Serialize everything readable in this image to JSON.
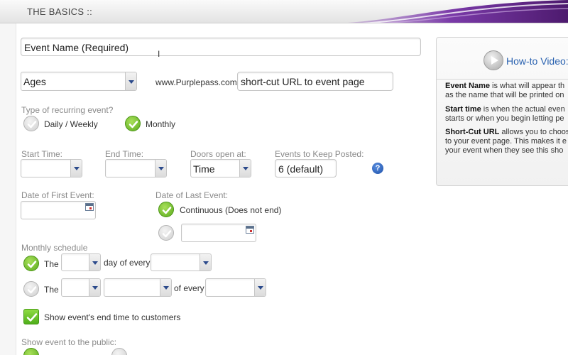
{
  "header": {
    "title": "THE BASICS ::"
  },
  "form": {
    "event_name": {
      "placeholder": "Event Name (Required)"
    },
    "ages": {
      "value": "Ages"
    },
    "url_prefix": "www.Purplepass.com/",
    "shortcut_url": {
      "placeholder": "short-cut URL to event page"
    },
    "recurring": {
      "label": "Type of recurring event?",
      "options": [
        {
          "label": "Daily / Weekly",
          "selected": false
        },
        {
          "label": "Monthly",
          "selected": true
        }
      ]
    },
    "start_time": {
      "label": "Start Time:",
      "value": ""
    },
    "end_time": {
      "label": "End Time:",
      "value": ""
    },
    "doors_open": {
      "label": "Doors open at:",
      "value": "Time"
    },
    "events_to_keep": {
      "label": "Events to Keep Posted:",
      "value": "6 (default)"
    },
    "help_icon": "?",
    "first_event": {
      "label": "Date of First Event:"
    },
    "last_event": {
      "label": "Date of Last Event:",
      "continuous_label": "Continuous (Does not end)",
      "continuous_selected": true
    },
    "monthly_schedule": {
      "label": "Monthly schedule",
      "row1": {
        "the": "The",
        "day_of_every": "day of every",
        "selected": true
      },
      "row2": {
        "the": "The",
        "of_every": "of every",
        "selected": false
      }
    },
    "show_end_time": {
      "label": "Show event's end time to customers",
      "checked": true
    },
    "show_public": {
      "label": "Show event to the public:"
    }
  },
  "side_panel": {
    "howto": "How-to Video:",
    "paragraphs": [
      {
        "bold": "Event Name",
        "lines": [
          " is what will appear th",
          "as the name that will be printed on"
        ]
      },
      {
        "bold": "Start time",
        "lines": [
          " is when the actual even",
          "starts or when you begin letting pe"
        ]
      },
      {
        "bold": "Short-Cut URL",
        "lines": [
          " allows you to choos",
          "to your event page. This makes it e",
          "your event when they see this sho"
        ]
      }
    ]
  },
  "colors": {
    "accent_purple": "#6a2c8c",
    "green_check": "#5cab1e",
    "link_blue": "#2a62b0"
  }
}
